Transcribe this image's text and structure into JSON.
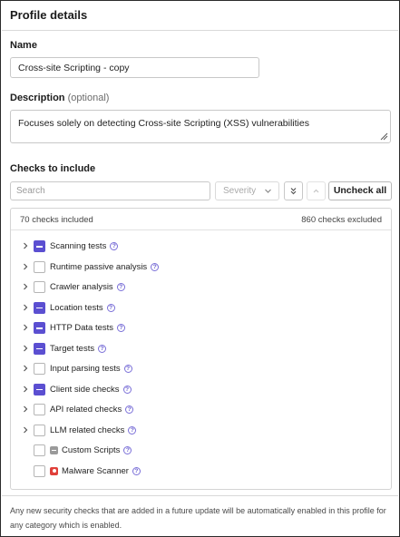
{
  "header": {
    "title": "Profile details"
  },
  "name_field": {
    "label": "Name",
    "value": "Cross-site Scripting - copy"
  },
  "description_field": {
    "label": "Description",
    "optional_label": "(optional)",
    "value": "Focuses solely on detecting Cross-site Scripting (XSS) vulnerabilities"
  },
  "checks": {
    "label": "Checks to include",
    "search_placeholder": "Search",
    "severity_placeholder": "Severity",
    "uncheck_all_label": "Uncheck all",
    "included_count": "70 checks included",
    "excluded_count": "860 checks excluded",
    "items": [
      {
        "label": "Scanning tests",
        "state": "partial",
        "expandable": true,
        "help": true
      },
      {
        "label": "Runtime passive analysis",
        "state": "unchecked",
        "expandable": true,
        "help": true
      },
      {
        "label": "Crawler analysis",
        "state": "unchecked",
        "expandable": true,
        "help": true
      },
      {
        "label": "Location tests",
        "state": "partial",
        "expandable": true,
        "help": true
      },
      {
        "label": "HTTP Data tests",
        "state": "partial",
        "expandable": true,
        "help": true
      },
      {
        "label": "Target tests",
        "state": "partial",
        "expandable": true,
        "help": true
      },
      {
        "label": "Input parsing tests",
        "state": "unchecked",
        "expandable": true,
        "help": true
      },
      {
        "label": "Client side checks",
        "state": "partial",
        "expandable": true,
        "help": true
      },
      {
        "label": "API related checks",
        "state": "unchecked",
        "expandable": true,
        "help": true
      },
      {
        "label": "LLM related checks",
        "state": "unchecked",
        "expandable": true,
        "help": true
      },
      {
        "label": "Custom Scripts",
        "state": "unchecked",
        "expandable": false,
        "help": true,
        "icon": "scripts-icon"
      },
      {
        "label": "Malware Scanner",
        "state": "unchecked",
        "expandable": false,
        "help": true,
        "icon": "malware-icon"
      }
    ]
  },
  "footer": {
    "note": "Any new security checks that are added in a future update will be automatically enabled in this profile for any category which is enabled."
  },
  "colors": {
    "accent": "#5b4fd1",
    "danger": "#e0403a",
    "border": "#c8c8c8"
  }
}
